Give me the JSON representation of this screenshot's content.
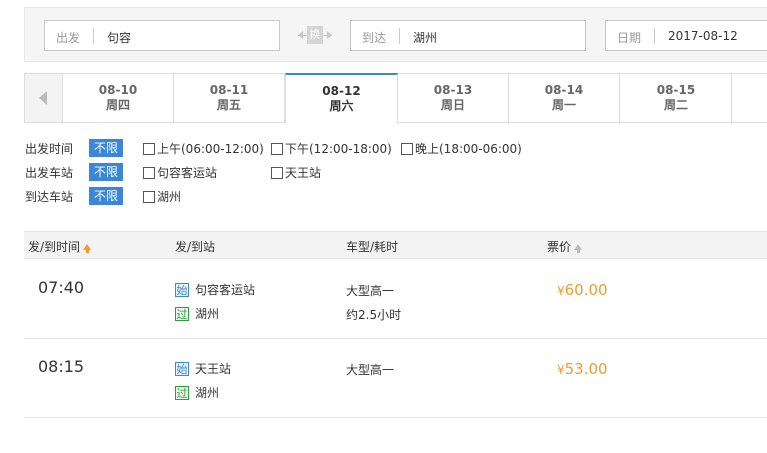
{
  "search": {
    "from_label": "出发",
    "from_value": "句容",
    "swap_label": "换",
    "to_label": "到达",
    "to_value": "湖州",
    "date_label": "日期",
    "date_value": "2017-08-12"
  },
  "date_tabs": [
    {
      "date": "08-10",
      "weekday": "周四",
      "active": false
    },
    {
      "date": "08-11",
      "weekday": "周五",
      "active": false
    },
    {
      "date": "08-12",
      "weekday": "周六",
      "active": true
    },
    {
      "date": "08-13",
      "weekday": "周日",
      "active": false
    },
    {
      "date": "08-14",
      "weekday": "周一",
      "active": false
    },
    {
      "date": "08-15",
      "weekday": "周二",
      "active": false
    }
  ],
  "filters": {
    "depart_time": {
      "label": "出发时间",
      "unlimited": "不限",
      "options": [
        "上午(06:00-12:00)",
        "下午(12:00-18:00)",
        "晚上(18:00-06:00)"
      ]
    },
    "depart_station": {
      "label": "出发车站",
      "unlimited": "不限",
      "options": [
        "句容客运站",
        "天王站"
      ]
    },
    "arrive_station": {
      "label": "到达车站",
      "unlimited": "不限",
      "options": [
        "湖州"
      ]
    }
  },
  "table": {
    "headers": {
      "time": "发/到时间",
      "station": "发/到站",
      "bus": "车型/耗时",
      "price": "票价"
    },
    "rows": [
      {
        "time": "07:40",
        "start_tag": "始",
        "start_station": "句容客运站",
        "pass_tag": "过",
        "end_station": "湖州",
        "bus_type": "大型高一",
        "duration": "约2.5小时",
        "currency": "¥",
        "price": "60.00"
      },
      {
        "time": "08:15",
        "start_tag": "始",
        "start_station": "天王站",
        "pass_tag": "过",
        "end_station": "湖州",
        "bus_type": "大型高一",
        "duration": "",
        "currency": "¥",
        "price": "53.00"
      }
    ]
  },
  "colors": {
    "accent": "#3b86d6",
    "price": "#f29a2e"
  }
}
